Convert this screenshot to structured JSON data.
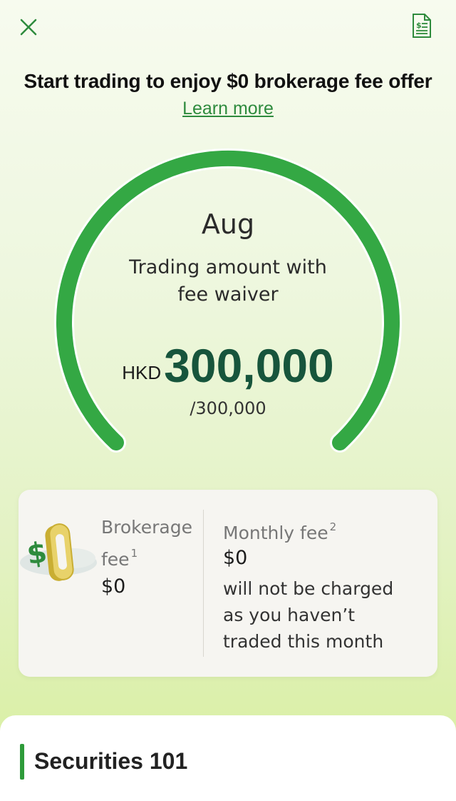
{
  "header": {
    "close_icon": "close-icon",
    "document_icon": "fee-document-icon"
  },
  "promo": {
    "headline": "Start trading to enjoy $0 brokerage fee offer",
    "learn_more": "Learn more"
  },
  "gauge": {
    "month": "Aug",
    "subtitle_line1": "Trading amount with",
    "subtitle_line2": "fee waiver",
    "currency": "HKD",
    "amount": "300,000",
    "limit": "/300,000",
    "progress": 1.0,
    "color": "#34a844"
  },
  "fees": {
    "brokerage_label": "Brokerage",
    "brokerage_label_cont": "fee",
    "brokerage_sup": "1",
    "brokerage_value": "$0",
    "monthly_label": "Monthly fee",
    "monthly_sup": "2",
    "monthly_value": "$0",
    "monthly_note_1": "will not be charged",
    "monthly_note_2": "as you haven’t",
    "monthly_note_3": "traded this month"
  },
  "section": {
    "title": "Securities 101"
  },
  "colors": {
    "accent": "#2e9b3a",
    "amount": "#17553c"
  }
}
